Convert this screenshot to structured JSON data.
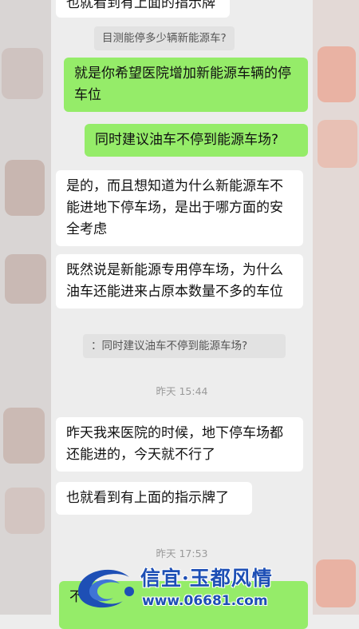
{
  "messages": {
    "top_partial": "也就看到有上面的指示牌",
    "q1": "目测能停多少辆新能源车?",
    "m1": "就是你希望医院增加新能源车辆的停车位",
    "m2": "同时建议油车不停到能源车场?",
    "m3": "是的，而且想知道为什么新能源车不能进地下停车场，是出于哪方面的安全考虑",
    "m4": "既然说是新能源专用停车场，为什么油车还能进来占原本数量不多的车位",
    "q2": "：同时建议油车不停到能源车场?",
    "t1": "昨天 15:44",
    "m5": "昨天我来医院的时候，地下停车场都还能进的，今天就不行了",
    "m6": "也就看到有上面的指示牌了",
    "t2": "昨天 17:53",
    "m7_partial": "不"
  },
  "watermark": {
    "title": "信宜·玉都风情",
    "url": "www.06681.com"
  },
  "colors": {
    "background": "#ededed",
    "outgoing_bubble": "#95ec69",
    "incoming_bubble": "#ffffff",
    "watermark_blue": "#1e4fb5"
  }
}
